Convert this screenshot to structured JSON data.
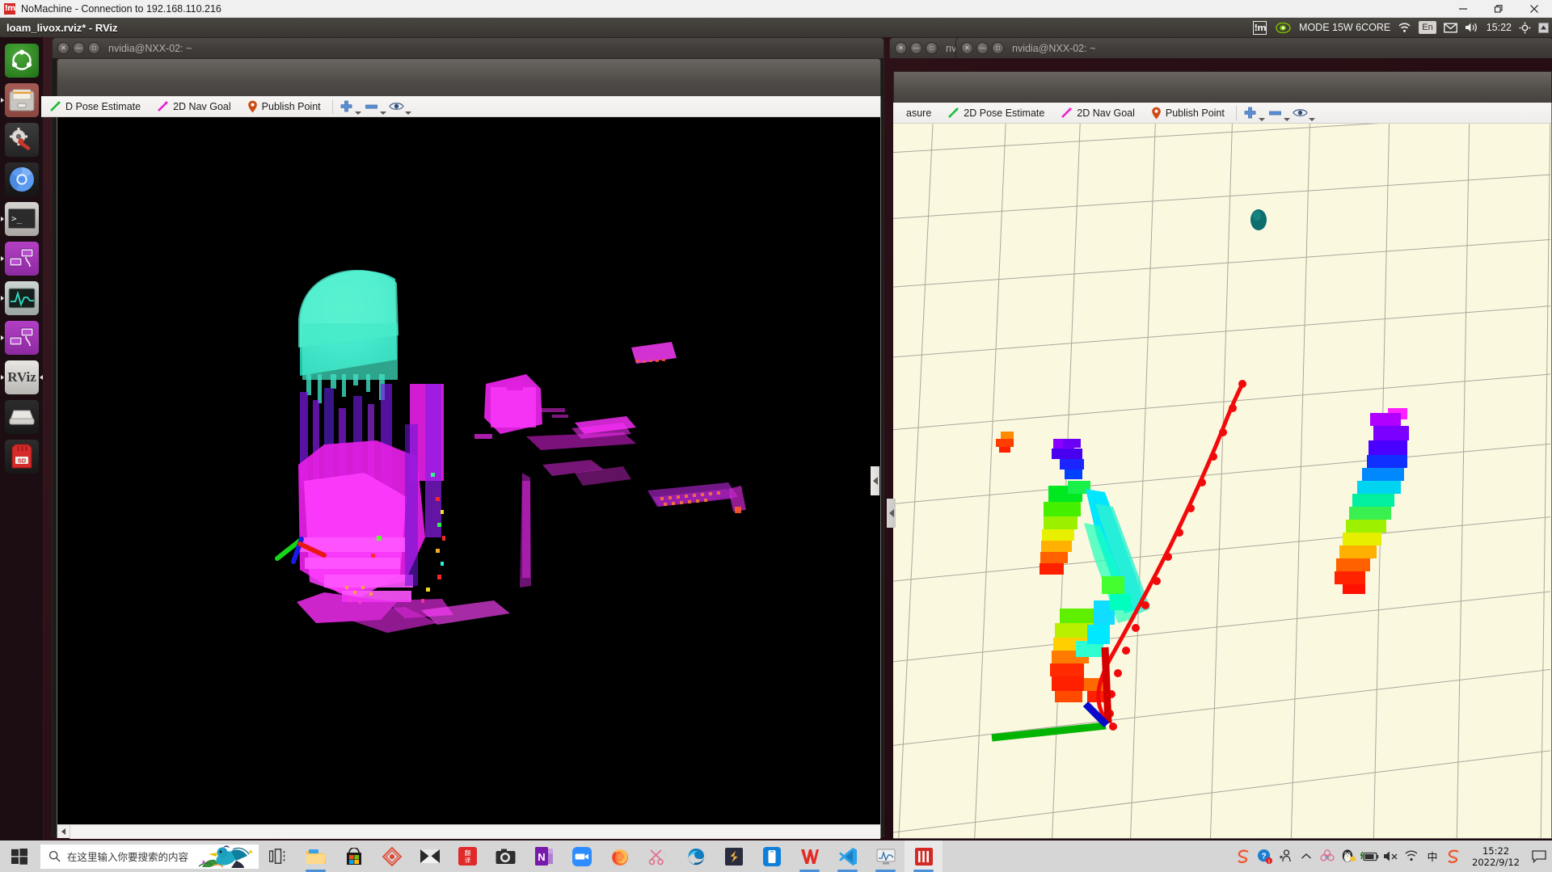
{
  "nomachine": {
    "icon_text": "!m",
    "title": "NoMachine - Connection to 192.168.110.216",
    "window_buttons": {
      "minimize": "—",
      "restore": "❐",
      "close": "✕"
    }
  },
  "ubuntu_panel": {
    "app_name": "loam_livox.rviz* - RViz",
    "nomachine_indicator": "!m",
    "nvidia_icon": "nvidia-icon",
    "power_mode": "MODE 15W 6CORE",
    "wifi_icon": "wifi-icon",
    "language": "En",
    "mail_icon": "mail-icon",
    "volume_icon": "volume-icon",
    "clock": "15:22",
    "gear_icon": "gear-icon",
    "caret_icon": "caret-up-icon"
  },
  "launcher": {
    "items": [
      {
        "name": "ubuntu-dash",
        "label": "Ubuntu Dash",
        "icon": "ubuntu-logo-icon"
      },
      {
        "name": "files",
        "label": "Files",
        "icon": "file-manager-icon"
      },
      {
        "name": "system-settings",
        "label": "System Settings",
        "icon": "gear-wrench-icon"
      },
      {
        "name": "chromium",
        "label": "Chromium",
        "icon": "chromium-icon"
      },
      {
        "name": "terminal",
        "label": "Terminal",
        "icon": "terminal-icon"
      },
      {
        "name": "rqt-graph",
        "label": "rqt",
        "icon": "network-nodes-icon"
      },
      {
        "name": "system-monitor",
        "label": "System Monitor",
        "icon": "waveform-icon"
      },
      {
        "name": "rqt-2",
        "label": "rqt",
        "icon": "network-nodes-icon"
      },
      {
        "name": "rviz",
        "label": "RViz",
        "icon": "rviz-icon"
      },
      {
        "name": "disk",
        "label": "Disk",
        "icon": "drive-icon"
      },
      {
        "name": "sd-card",
        "label": "SD Card",
        "icon": "sd-card-icon"
      }
    ]
  },
  "terminals": [
    {
      "title": "nvidia@NXX-02: ~"
    },
    {
      "title": "nvidia@NXX-02: ~"
    },
    {
      "title": "nv"
    },
    {
      "title": "nvidia@NXX-02: ~"
    }
  ],
  "rviz_left": {
    "toolbar": {
      "pose_estimate": "D Pose Estimate",
      "nav_goal": "2D Nav Goal",
      "publish_point": "Publish Point",
      "zoom_in": "+",
      "zoom_out": "−",
      "focus": "eye-icon"
    },
    "view": {
      "background": "#000000",
      "cloud_colors": [
        "#ff00ff",
        "#7fffd4",
        "#b000ff",
        "#00ffaa",
        "#ff2020"
      ]
    },
    "scrollbar": {
      "left_arrow": "◀"
    }
  },
  "rviz_right": {
    "toolbar": {
      "measure": "asure",
      "pose_estimate": "2D Pose Estimate",
      "nav_goal": "2D Nav Goal",
      "publish_point": "Publish Point",
      "zoom_in": "+",
      "zoom_out": "−",
      "focus": "eye-icon"
    },
    "view": {
      "background": "#fbf8e0",
      "grid_color": "#9b9a92",
      "trajectory_color": "#f20a0a",
      "marker_color": "#0e6b6b"
    }
  },
  "taskbar": {
    "start": "windows-logo-icon",
    "search_placeholder": "在这里输入你要搜索的内容",
    "search_icon": "search-icon",
    "bird_icon": "bird-illustration-icon",
    "pinned": [
      {
        "name": "task-view",
        "icon": "task-view-icon"
      },
      {
        "name": "explorer",
        "icon": "folder-icon",
        "running": true
      },
      {
        "name": "store",
        "icon": "store-icon"
      },
      {
        "name": "wps-shield",
        "icon": "shield-icon"
      },
      {
        "name": "mail",
        "icon": "mail-icon"
      },
      {
        "name": "youdao",
        "icon": "youdao-icon",
        "label": "翻译"
      },
      {
        "name": "camera",
        "icon": "camera-icon"
      },
      {
        "name": "onenote",
        "icon": "onenote-icon"
      },
      {
        "name": "zoom",
        "icon": "zoom-video-icon",
        "running": true
      },
      {
        "name": "firefox",
        "icon": "firefox-icon",
        "running": true
      },
      {
        "name": "snip",
        "icon": "snipping-tool-icon",
        "running": true
      },
      {
        "name": "edge",
        "icon": "edge-icon"
      },
      {
        "name": "sublime",
        "icon": "sublime-icon"
      },
      {
        "name": "phone-link",
        "icon": "phone-icon",
        "running": true
      },
      {
        "name": "wps",
        "icon": "wps-icon",
        "running": true
      },
      {
        "name": "vscode",
        "icon": "vscode-icon",
        "running": true
      },
      {
        "name": "monitor-app",
        "icon": "monitor-icon",
        "running": true
      },
      {
        "name": "nomachine",
        "icon": "nomachine-icon",
        "running": true,
        "active": true
      }
    ],
    "tray": [
      {
        "name": "sogou-input",
        "icon": "sogou-icon"
      },
      {
        "name": "help-badge",
        "icon": "help-icon"
      },
      {
        "name": "people",
        "icon": "people-icon"
      },
      {
        "name": "show-hidden",
        "icon": "chevron-up-icon"
      },
      {
        "name": "antivirus",
        "icon": "flower-icon"
      },
      {
        "name": "qq",
        "icon": "penguin-icon"
      },
      {
        "name": "battery",
        "icon": "battery-charging-icon"
      },
      {
        "name": "volume-muted",
        "icon": "volume-mute-icon"
      },
      {
        "name": "network",
        "icon": "wifi-icon"
      },
      {
        "name": "ime-mode",
        "icon": "ime-icon",
        "label": "中"
      },
      {
        "name": "sogou-2",
        "icon": "sogou-icon"
      }
    ],
    "clock": {
      "time": "15:22",
      "date": "2022/9/12"
    },
    "action_center": "notification-icon"
  }
}
